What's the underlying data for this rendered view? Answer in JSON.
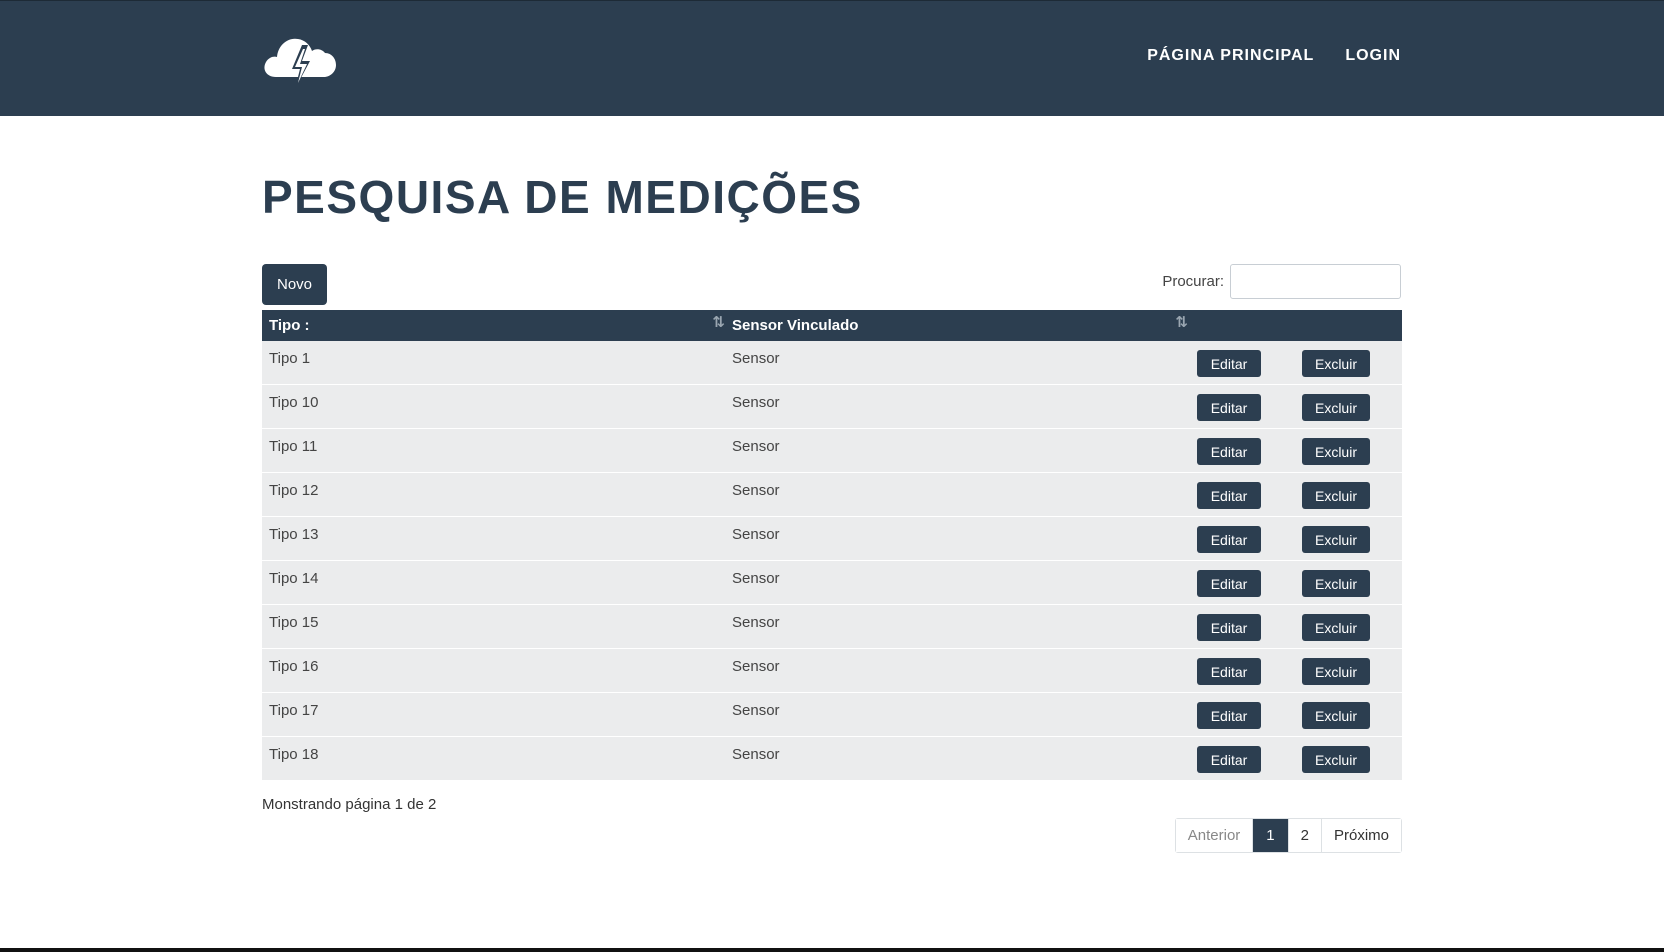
{
  "navbar": {
    "logo_icon": "cloud-lightning-icon",
    "links": [
      {
        "label": "PÁGINA PRINCIPAL"
      },
      {
        "label": "LOGIN"
      }
    ]
  },
  "page": {
    "title": "PESQUISA DE MEDIÇÕES"
  },
  "toolbar": {
    "new_label": "Novo",
    "search_label": "Procurar:",
    "search_value": "",
    "search_placeholder": ""
  },
  "table": {
    "headers": {
      "tipo": "Tipo :",
      "sensor": "Sensor Vinculado"
    },
    "rows": [
      {
        "tipo": "Tipo 1",
        "sensor": "Sensor"
      },
      {
        "tipo": "Tipo 10",
        "sensor": "Sensor"
      },
      {
        "tipo": "Tipo 11",
        "sensor": "Sensor"
      },
      {
        "tipo": "Tipo 12",
        "sensor": "Sensor"
      },
      {
        "tipo": "Tipo 13",
        "sensor": "Sensor"
      },
      {
        "tipo": "Tipo 14",
        "sensor": "Sensor"
      },
      {
        "tipo": "Tipo 15",
        "sensor": "Sensor"
      },
      {
        "tipo": "Tipo 16",
        "sensor": "Sensor"
      },
      {
        "tipo": "Tipo 17",
        "sensor": "Sensor"
      },
      {
        "tipo": "Tipo 18",
        "sensor": "Sensor"
      }
    ],
    "edit_label": "Editar",
    "delete_label": "Excluir"
  },
  "footer": {
    "showing": "Monstrando página 1 de 2",
    "pagination": {
      "prev": "Anterior",
      "pages": [
        "1",
        "2"
      ],
      "next": "Próximo",
      "current": "1"
    }
  },
  "colors": {
    "primary": "#2c3e50",
    "row_bg": "#ebeced"
  }
}
